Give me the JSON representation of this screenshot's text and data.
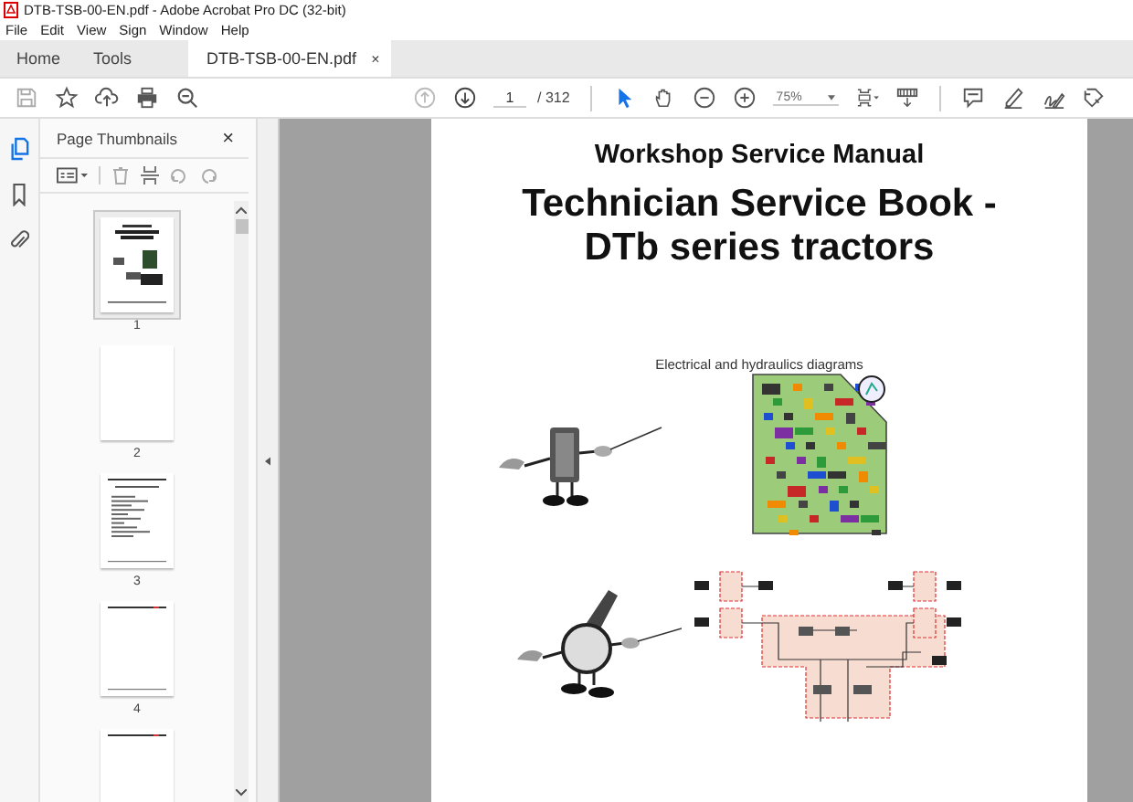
{
  "window": {
    "title": "DTB-TSB-00-EN.pdf - Adobe Acrobat Pro DC (32-bit)"
  },
  "menu": [
    "File",
    "Edit",
    "View",
    "Sign",
    "Window",
    "Help"
  ],
  "tabs": [
    {
      "label": "Home",
      "selected": false
    },
    {
      "label": "Tools",
      "selected": false
    },
    {
      "label": "DTB-TSB-00-EN.pdf",
      "selected": true,
      "close": "×"
    }
  ],
  "toolbar": {
    "page_number": "1",
    "page_count": "/ 312",
    "zoom": "75%",
    "tools": [
      {
        "kind": "select",
        "selected": true
      },
      {
        "kind": "hand",
        "selected": false
      }
    ]
  },
  "sidebar": {
    "rail": [
      {
        "kind": "thumbnails",
        "selected": true
      },
      {
        "kind": "bookmarks",
        "selected": false
      },
      {
        "kind": "attachments",
        "selected": false
      }
    ],
    "title": "Page Thumbnails",
    "close": "×",
    "thumbnails": [
      {
        "kind": "cover",
        "label": "1",
        "selected": true
      },
      {
        "kind": "blank",
        "label": "2",
        "selected": false
      },
      {
        "kind": "list",
        "label": "3",
        "selected": false
      },
      {
        "kind": "text",
        "label": "4",
        "selected": false
      },
      {
        "kind": "text",
        "selected": false
      }
    ]
  },
  "page": {
    "heading": "Workshop Service Manual",
    "title": [
      "Technician Service Book -",
      "DTb series tractors"
    ],
    "caption": "Electrical and hydraulics diagrams"
  }
}
